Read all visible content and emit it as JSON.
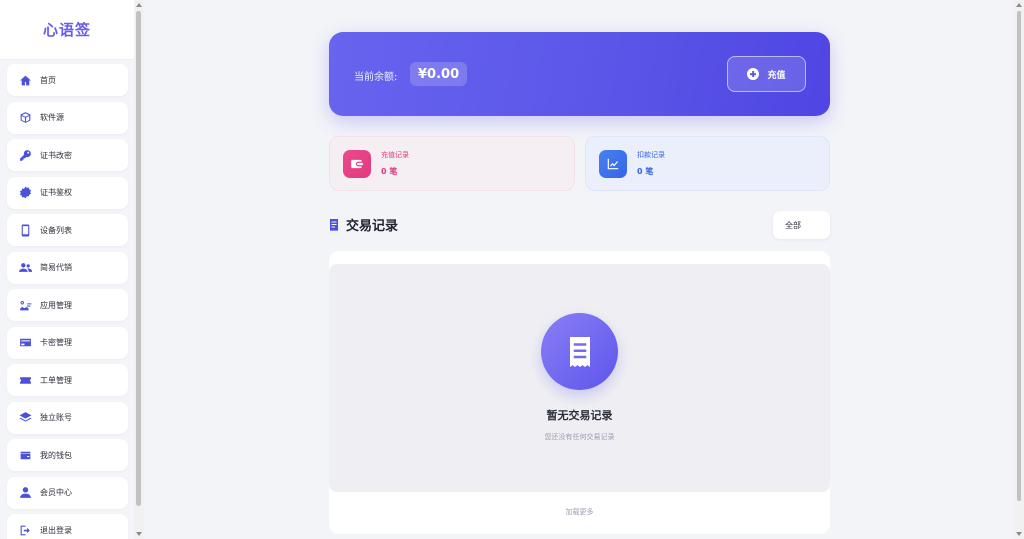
{
  "sidebar": {
    "brand": "心语签",
    "items": [
      {
        "label": "首页",
        "icon": "home-icon"
      },
      {
        "label": "软件源",
        "icon": "box-icon"
      },
      {
        "label": "证书改密",
        "icon": "key-icon"
      },
      {
        "label": "证书鉴权",
        "icon": "badge-icon"
      },
      {
        "label": "设备列表",
        "icon": "phone-icon"
      },
      {
        "label": "简易代销",
        "icon": "users-icon"
      },
      {
        "label": "应用管理",
        "icon": "apps-icon"
      },
      {
        "label": "卡密管理",
        "icon": "card-icon"
      },
      {
        "label": "工单管理",
        "icon": "ticket-icon"
      },
      {
        "label": "独立账号",
        "icon": "layers-icon"
      },
      {
        "label": "我的钱包",
        "icon": "wallet-icon"
      },
      {
        "label": "会员中心",
        "icon": "user-icon"
      },
      {
        "label": "退出登录",
        "icon": "logout-icon"
      }
    ]
  },
  "balance": {
    "label": "当前余额:",
    "value": "¥0.00",
    "recharge_label": "充值"
  },
  "stats": {
    "recharge": {
      "title": "充值记录",
      "count": "0 笔"
    },
    "deduct": {
      "title": "扣款记录",
      "count": "0 笔"
    }
  },
  "transactions": {
    "title": "交易记录",
    "filter_value": "全部",
    "empty_title": "暂无交易记录",
    "empty_sub": "您还没有任何交易记录",
    "load_more": "加载更多"
  },
  "colors": {
    "accent": "#5b56e8",
    "pink": "#e23a7d",
    "blue": "#3466e5"
  }
}
